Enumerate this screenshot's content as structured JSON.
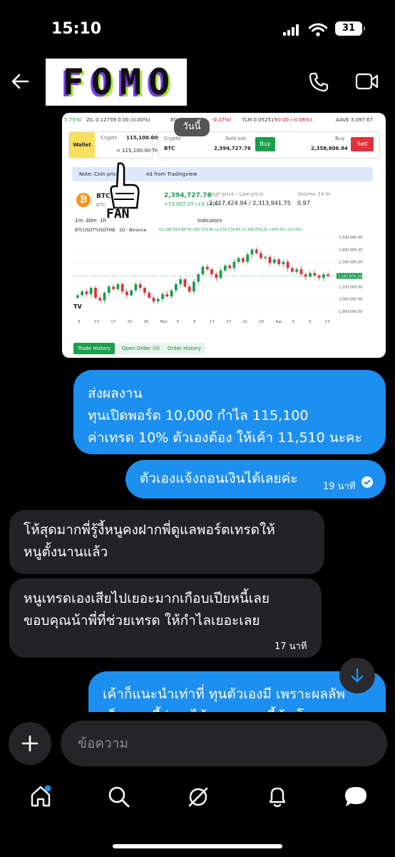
{
  "status_bar": {
    "time": "15:10",
    "battery": "31"
  },
  "header": {
    "logo_letters": [
      "F",
      "O",
      "M",
      "O"
    ]
  },
  "shared_image": {
    "today_badge": "วันนี้",
    "ticker": [
      {
        "text": "5.75%)",
        "cls": "pos"
      },
      {
        "text": "ZIL 0.12739 0.00 (0.00%)",
        "cls": ""
      },
      {
        "text": "EG",
        "cls": ""
      },
      {
        "text": "-0.27%)",
        "cls": "neg"
      },
      {
        "text": "TLM 0.052515",
        "cls": ""
      },
      {
        "text": "-0.00 (-0.06%)",
        "cls": "neg"
      },
      {
        "text": "AAVE 3,097.67",
        "cls": ""
      }
    ],
    "wallet_label": "Wallet",
    "crypto_label": "Crypto",
    "crypto_amount": "115,100.00",
    "crypto_thb": "= 115,100.00 THB",
    "pair_label": "Crypto",
    "pair_coin": "BTC",
    "sold_out_label": "Sold out",
    "sold_out_value": "2,394,727.76",
    "buy_button": "Buy",
    "buy_label": "Buy",
    "buy_value": "2,358,806.84",
    "sell_button": "Sell",
    "note": "Note: Coin prices",
    "note_tail": "ed from Tradingview",
    "coin_symbol": "BTC",
    "coin_sub": "BTC",
    "price": "2,394,727.76",
    "change": "+73,007.17 (+3.14%)",
    "high_low_label": "High price - Low price",
    "high_low": "2,417,424.94 / 2,313,941.75",
    "volume_label": "Volume 24 hr",
    "volume": "0.97",
    "timeframes": [
      "1m",
      "30m",
      "1h"
    ],
    "indicators_label": "Indicators",
    "symbol_line": "BTCUSDT*USDTHB · 1D · Binance",
    "ohlc_line": "O2,185,613.98  H2,193,773.46  L2,174,724.45  C2,185,876.20  +430.50 (+0.02%)",
    "y_ticks": [
      "2,500,000.00",
      "2,400,000.00",
      "2,300,000.00",
      "2,200,000.00",
      "2,100,000.00",
      "2,000,000.00",
      "1,900,000.00"
    ],
    "x_ticks": [
      "9",
      "13",
      "17",
      "21",
      "25",
      "Mar",
      "5",
      "9",
      "13",
      "17",
      "21",
      "25",
      "Apr",
      "5",
      "9",
      "13"
    ],
    "last_price_tag": "2,185,876.20",
    "tabs": [
      "Trade History",
      "Open Order (0)",
      "Order History"
    ],
    "sticker_text": "FAN"
  },
  "chart_data": {
    "type": "candlestick",
    "title": "BTCUSDT*USDTHB · 1D · Binance",
    "ylim": [
      1900000,
      2500000
    ],
    "closes": [
      2030000,
      2060000,
      2040000,
      2090000,
      2010000,
      1990000,
      2050000,
      2100000,
      2080000,
      2120000,
      2060000,
      2030000,
      2070000,
      2120000,
      2090000,
      2050000,
      2010000,
      1980000,
      2000000,
      2040000,
      2020000,
      2070000,
      2120000,
      2160000,
      2100000,
      2060000,
      2140000,
      2200000,
      2260000,
      2240000,
      2200000,
      2170000,
      2230000,
      2270000,
      2250000,
      2300000,
      2330000,
      2300000,
      2360000,
      2400000,
      2370000,
      2330000,
      2340000,
      2290000,
      2320000,
      2280000,
      2300000,
      2250000,
      2220000,
      2240000,
      2200000,
      2180000,
      2210000,
      2190000,
      2170000,
      2200000,
      2185876
    ]
  },
  "messages": [
    {
      "side": "out",
      "lines": [
        "ส่งผลงาน",
        "ทุนเปิดพอร์ต 10,000 กำไล 115,100",
        "ค่าเทรด 10% ตัวเองต้อง ให้เค้า 11,510 นะคะ"
      ]
    },
    {
      "side": "out",
      "text": "ตัวเองแจ้งถอนเงินได้เลยค่ะ",
      "time": "19 นาที"
    },
    {
      "side": "in",
      "lines": [
        "โห้สุดมากพี่รู้งี้หนูคงฝากพี่ดูแลพอร์ตเทรดให้",
        "หนูตั้งนานแล้ว"
      ]
    },
    {
      "side": "in",
      "lines": [
        "หนูเทรดเองเสียไปเยอะมากเกือบเปียหนี้เลย",
        "ขอบคุณน้าพี่ที่ช่วยเทรด ให้กำไลเยอะเลย"
      ],
      "time": "17 นาที"
    },
    {
      "side": "out",
      "lines": [
        "เค้าก็แนะนำเท่าที่ ทุนตัวเองมี เพราะผลลัพ",
        "เห็นตอนนี้ว่าจะได้มากขนาดนี้ค้า โดยบอกแบบ"
      ]
    }
  ],
  "composer": {
    "placeholder": "ข้อความ"
  }
}
